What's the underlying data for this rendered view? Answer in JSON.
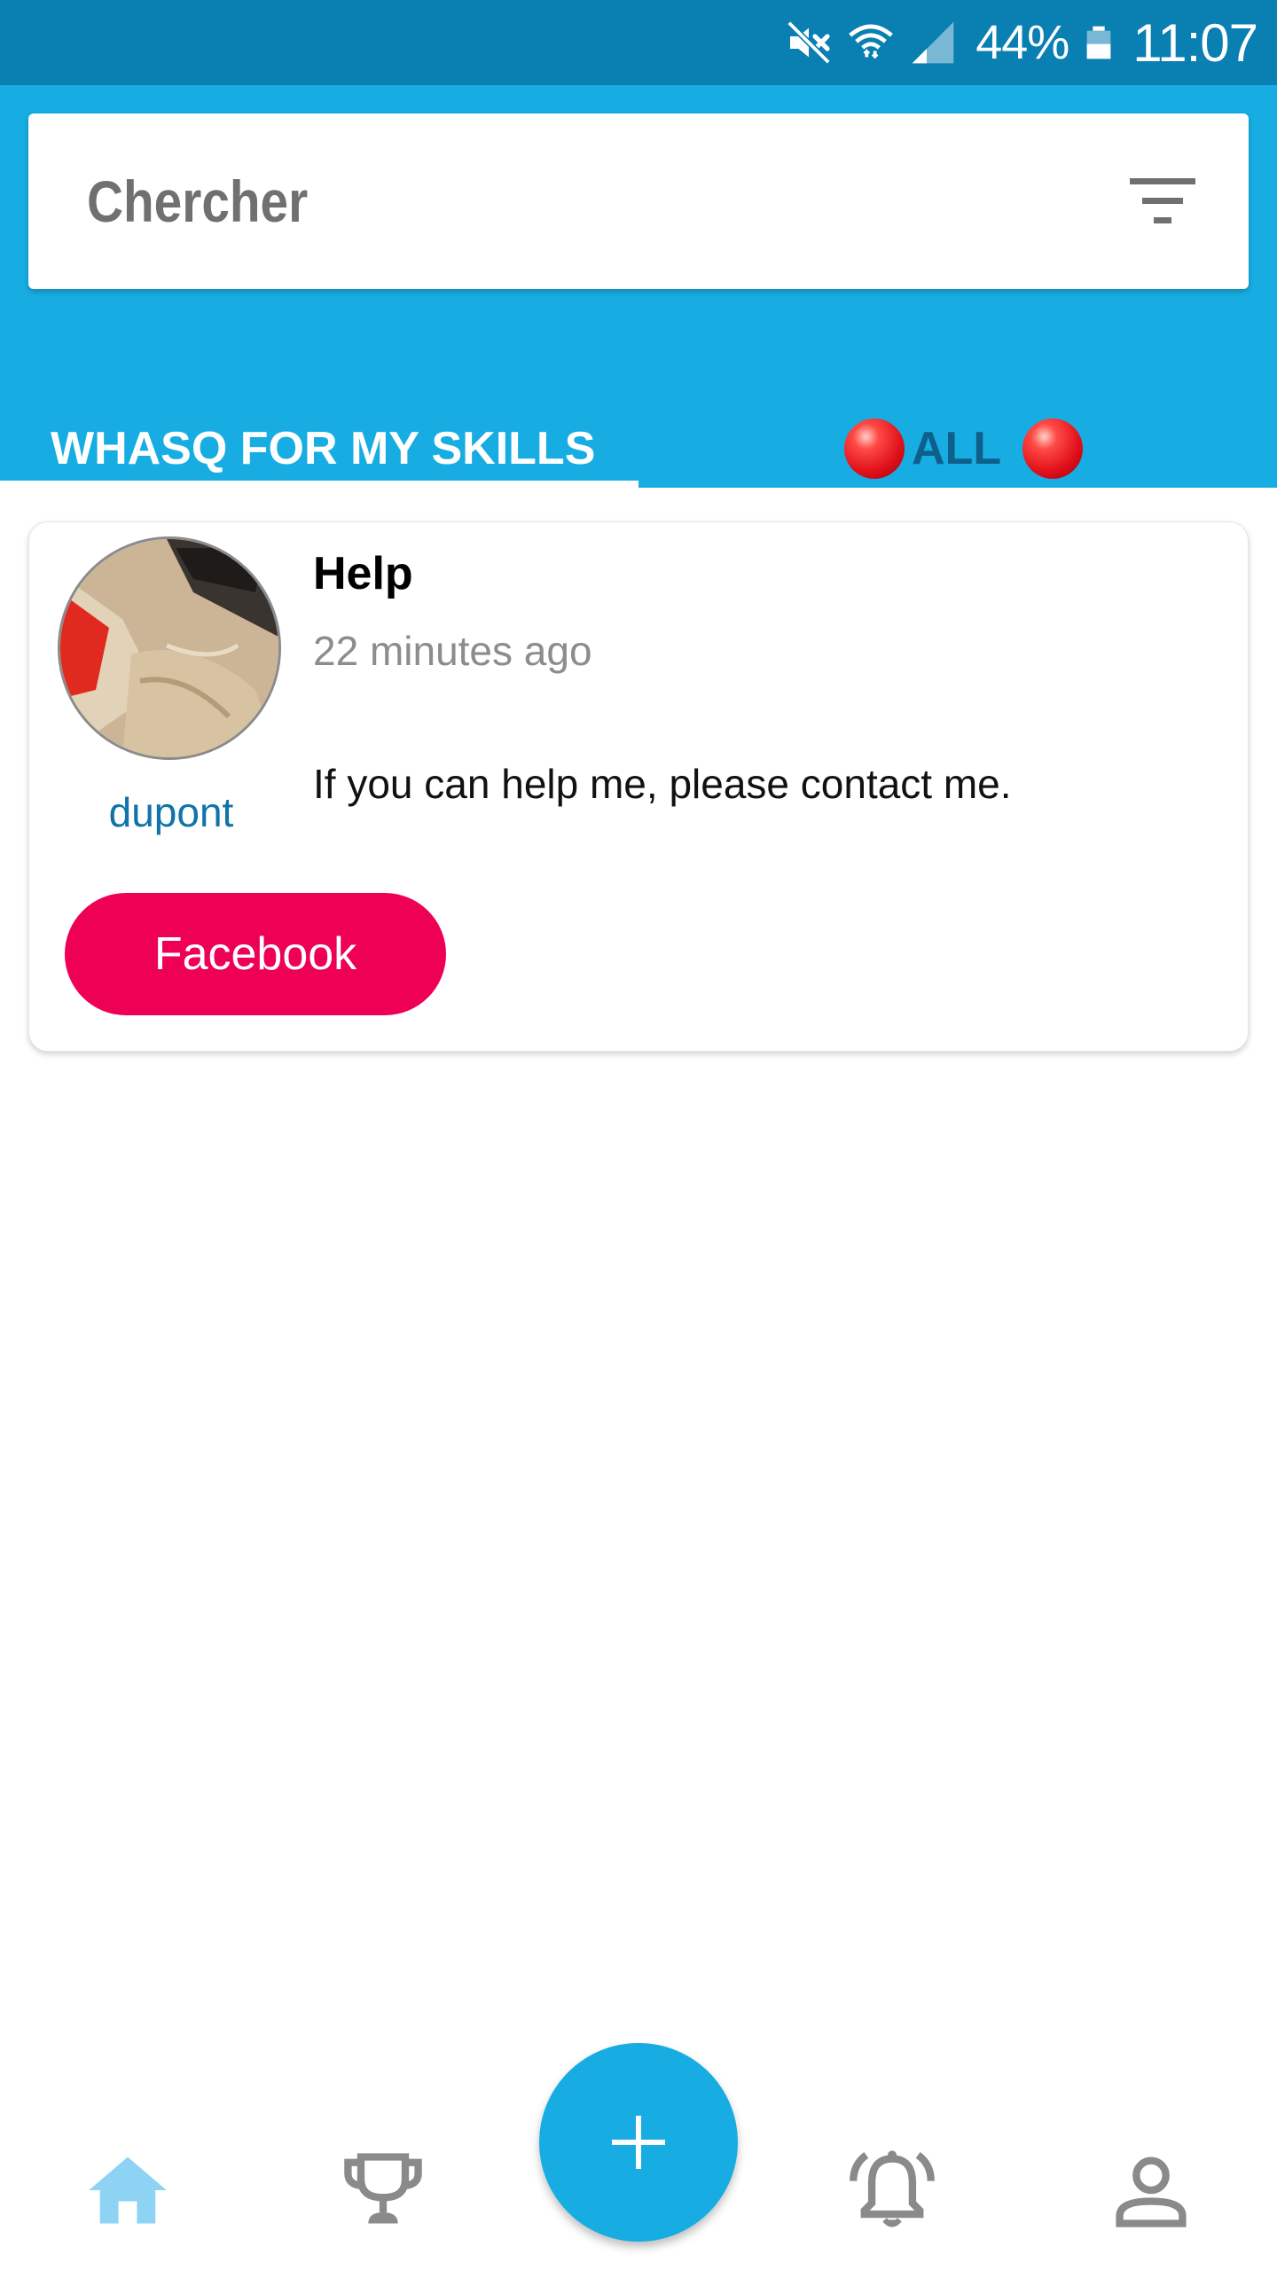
{
  "status_bar": {
    "battery_percent": "44%",
    "time": "11:07",
    "icons": [
      "mute-icon",
      "wifi-icon",
      "signal-icon",
      "battery-icon"
    ]
  },
  "search": {
    "placeholder": "Chercher",
    "filter_icon": "filter-icon"
  },
  "tabs": [
    {
      "label": "WHASQ FOR MY SKILLS",
      "selected": true
    },
    {
      "label": "ALL",
      "selected": false
    }
  ],
  "posts": [
    {
      "author": "dupont",
      "title": "Help",
      "time": "22 minutes ago",
      "body": "If you can help me, please contact me.",
      "button_label": "Facebook"
    }
  ],
  "bottom_nav": {
    "items": [
      "home-icon",
      "trophy-icon",
      "add-icon",
      "bell-icon",
      "profile-icon"
    ],
    "active": "home-icon"
  },
  "colors": {
    "status_bar": "#0a7fb2",
    "header": "#17ade2",
    "accent_button": "#ee0055",
    "author_link": "#0f74a8",
    "nav_active": "#8fd3f4",
    "nav_inactive": "#8a8a8a"
  }
}
